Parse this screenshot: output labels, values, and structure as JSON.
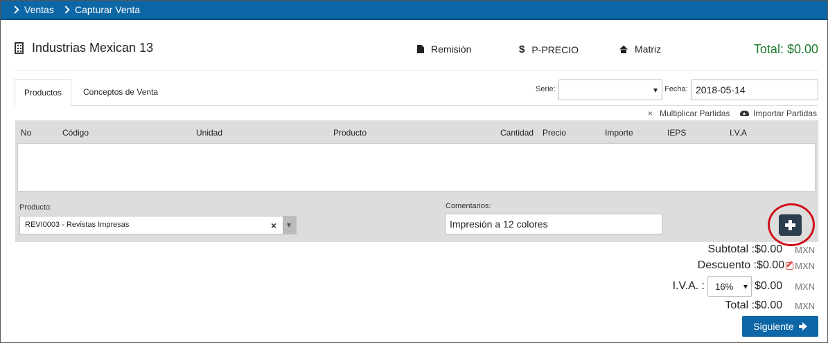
{
  "breadcrumb": [
    "Ventas",
    "Capturar Venta"
  ],
  "header": {
    "company": "Industrias Mexican 13",
    "links": [
      "Remisión",
      "P-PRECIO",
      "Matriz"
    ],
    "total": "Total: $0.00"
  },
  "tabs": [
    "Productos",
    "Conceptos de Venta"
  ],
  "filters": {
    "serie_label": "Serie:",
    "serie_value": "",
    "fecha_label": "Fecha:",
    "fecha_value": "2018-05-14"
  },
  "actions": {
    "multiplicar": "Multiplicar Partidas",
    "importar": "Importar Partidas"
  },
  "table": {
    "columns": [
      "No",
      "Código",
      "Unidad",
      "Producto",
      "Cantidad",
      "Precio",
      "Importe",
      "IEPS",
      "I.V.A"
    ],
    "rows": []
  },
  "form": {
    "producto_label": "Producto:",
    "producto_value": "REVI0003 - Revistas Impresas",
    "comentarios_label": "Comentarios:",
    "comentarios_value": "Impresión a 12 colores"
  },
  "summary": {
    "subtotal_label": "Subtotal :",
    "subtotal": "$0.00",
    "descuento_label": "Descuento :",
    "descuento": "$0.00",
    "iva_label": "I.V.A. :",
    "iva_rate": "16%",
    "iva": "$0.00",
    "total_label": "Total :",
    "total": "$0.00",
    "currency": "MXN"
  },
  "next_button": "Siguiente",
  "colors": {
    "topbar": "#0d66a6",
    "total_green": "#1e7a2e",
    "highlight_ring": "#d0101a",
    "add_button": "#2c3e50"
  }
}
